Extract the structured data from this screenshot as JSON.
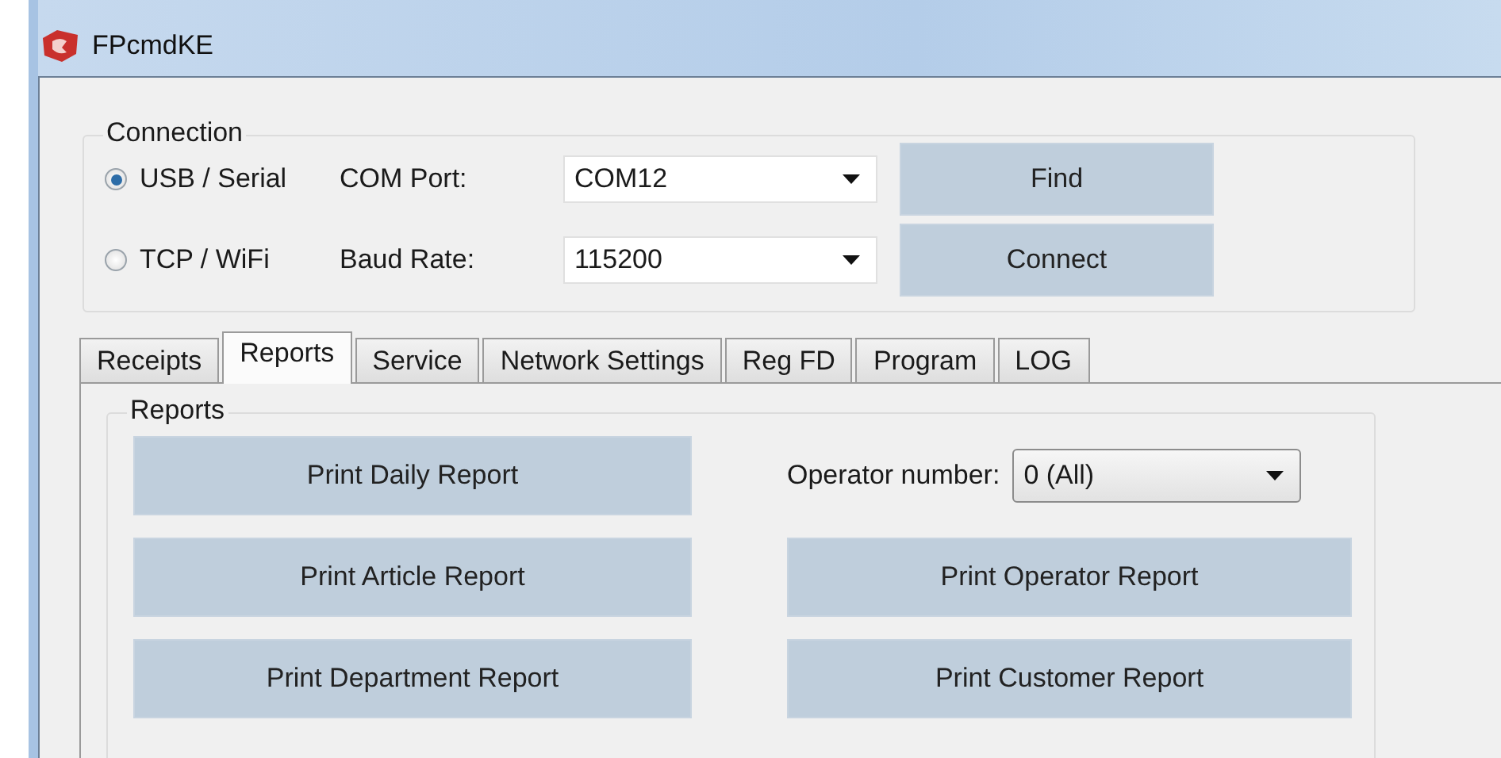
{
  "window": {
    "title": "FPcmdKE"
  },
  "connection": {
    "title": "Connection",
    "modes": [
      {
        "label": "USB / Serial",
        "selected": true
      },
      {
        "label": "TCP / WiFi",
        "selected": false
      }
    ],
    "fields": [
      {
        "label": "COM Port:",
        "value": "COM12"
      },
      {
        "label": "Baud Rate:",
        "value": "115200"
      }
    ],
    "buttons": [
      "Find",
      "Connect"
    ]
  },
  "tabs": [
    {
      "label": "Receipts",
      "selected": false
    },
    {
      "label": "Reports",
      "selected": true
    },
    {
      "label": "Service",
      "selected": false
    },
    {
      "label": "Network Settings",
      "selected": false
    },
    {
      "label": "Reg FD",
      "selected": false
    },
    {
      "label": "Program",
      "selected": false
    },
    {
      "label": "LOG",
      "selected": false
    }
  ],
  "reports": {
    "title": "Reports",
    "left_buttons": [
      "Print Daily Report",
      "Print Article Report",
      "Print Department Report"
    ],
    "operator": {
      "label": "Operator number:",
      "value": "0 (All)"
    },
    "right_buttons": [
      "Print Operator Report",
      "Print Customer Report"
    ]
  }
}
